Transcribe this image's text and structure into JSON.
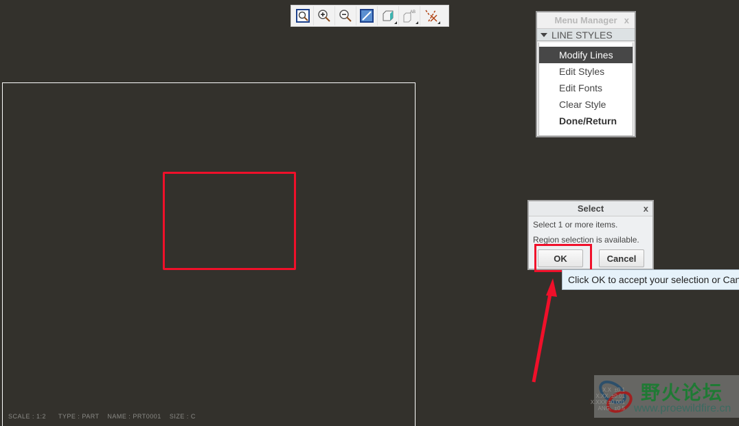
{
  "toolbar": {
    "icons": [
      "zoom-window-icon",
      "zoom-in-icon",
      "zoom-out-icon",
      "repaint-icon",
      "display-style-icon",
      "annotation-display-icon",
      "datum-display-icon"
    ]
  },
  "status_bar": {
    "scale": "SCALE : 1:2",
    "type": "TYPE : PART",
    "name": "NAME : PRT0001",
    "size": "SIZE : C"
  },
  "menu_manager": {
    "title": "Menu Manager",
    "close": "x",
    "section": "LINE STYLES",
    "items": [
      {
        "label": "Modify Lines",
        "selected": true
      },
      {
        "label": "Edit Styles"
      },
      {
        "label": "Edit Fonts"
      },
      {
        "label": "Clear Style"
      },
      {
        "label": "Done/Return",
        "bold": true
      }
    ]
  },
  "select_dialog": {
    "title": "Select",
    "close": "x",
    "line1": "Select 1 or more items.",
    "line2": "Region selection is available.",
    "ok": "OK",
    "cancel": "Cancel"
  },
  "tooltip": "Click OK to accept your selection or Cancel",
  "tolerances": "X.X  ±0.1\nX.XX  ±0.01\nX.XXX ±0.001\nANG.  ±0.5",
  "watermark": {
    "name": "野火论坛",
    "url": "www.proewildfire.cn"
  },
  "colors": {
    "background": "#33312c",
    "highlight": "#f0102a"
  }
}
